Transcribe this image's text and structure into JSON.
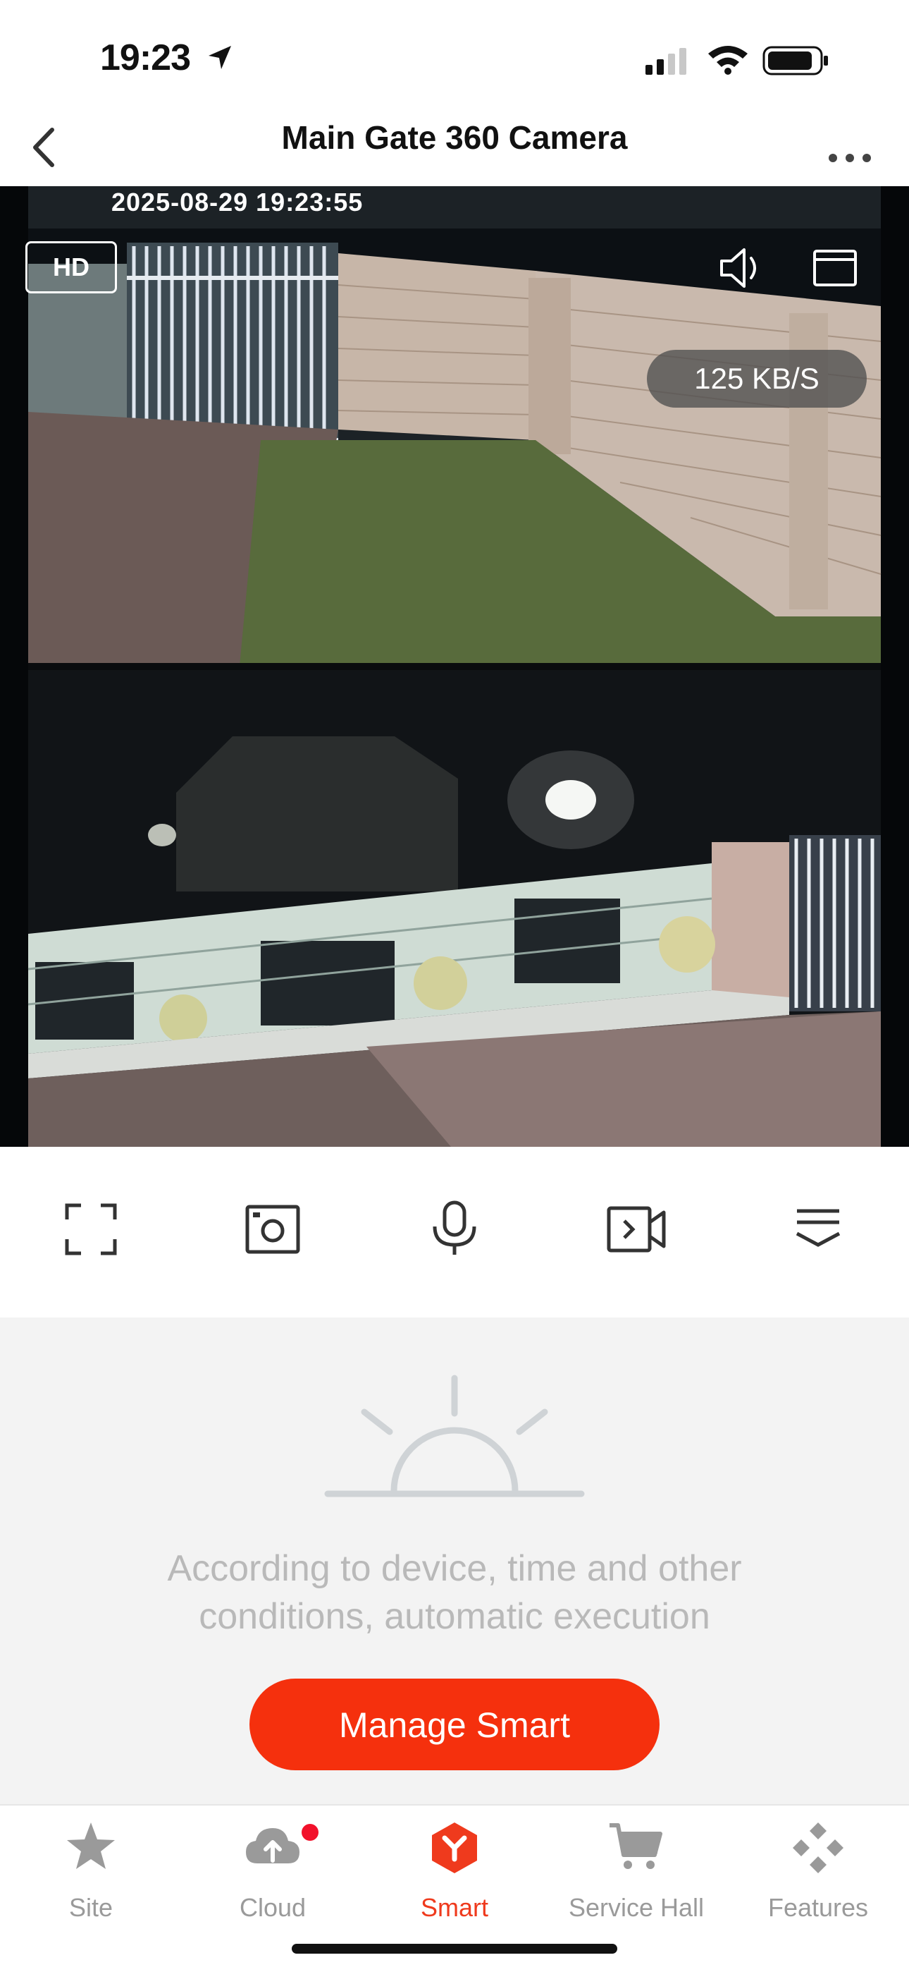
{
  "status_bar": {
    "time": "19:23"
  },
  "nav": {
    "title": "Main Gate 360 Camera"
  },
  "video": {
    "timestamp": "2025-08-29 19:23:55",
    "quality_label": "HD",
    "bitrate": "125 KB/S"
  },
  "controls": {
    "items": [
      "fullscreen-icon",
      "snapshot-icon",
      "microphone-icon",
      "record-icon",
      "more-options-icon"
    ]
  },
  "smart": {
    "empty_text": "According to device, time and other conditions, automatic execution",
    "button_label": "Manage Smart"
  },
  "tabs": [
    {
      "label": "Site",
      "icon": "star-icon",
      "active": false
    },
    {
      "label": "Cloud",
      "icon": "cloud-upload-icon",
      "active": false,
      "badge_dot": true
    },
    {
      "label": "Smart",
      "icon": "smart-icon",
      "active": true
    },
    {
      "label": "Service Hall",
      "icon": "cart-icon",
      "active": false
    },
    {
      "label": "Features",
      "icon": "features-icon",
      "active": false
    }
  ],
  "colors": {
    "accent": "#f5300d",
    "tab_active": "#ef3a1d",
    "tab_inactive": "#9a9a9a",
    "badge": "#f2112b",
    "smart_bg": "#f3f3f3"
  }
}
